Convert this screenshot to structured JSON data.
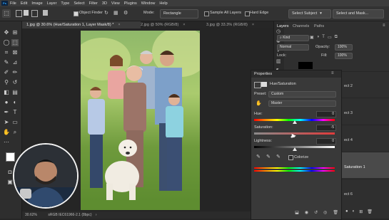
{
  "menu": [
    "File",
    "Edit",
    "Image",
    "Layer",
    "Type",
    "Select",
    "Filter",
    "3D",
    "View",
    "Plugins",
    "Window",
    "Help"
  ],
  "app_icon": "Ps",
  "options": {
    "object_finder": "Object Finder",
    "mode_label": "Mode:",
    "mode_value": "Rectangle",
    "sample_all_layers": "Sample All Layers",
    "hard_edge": "Hard Edge",
    "select_subject": "Select Subject",
    "select_and_mask": "Select and Mask..."
  },
  "tabs": [
    {
      "label": "1.jpg @ 30.6% (Hue/Saturation 1, Layer Mask/8) *"
    },
    {
      "label": "2.jpg @ 50% (RGB/8)"
    },
    {
      "label": "3.jpg @ 33.3% (RGB/8)"
    }
  ],
  "status": {
    "zoom": "30.62%",
    "info": "sRGB IEC61966-2.1 (8bpc)"
  },
  "layers_panel": {
    "tabs": [
      "Layers",
      "Channels",
      "Paths"
    ],
    "kind_label": "Kind",
    "blend_mode": "Normal",
    "opacity_label": "Opacity:",
    "opacity_value": "100%",
    "lock_label": "Lock:",
    "fill_label": "Fill:",
    "fill_value": "100%",
    "layers": [
      {
        "name": "ect 2"
      },
      {
        "name": "ect 3"
      },
      {
        "name": "ect 4"
      },
      {
        "name": "Saturation 1"
      },
      {
        "name": "ect 6"
      }
    ]
  },
  "properties": {
    "title": "Properties",
    "adjustment": "Hue/Saturation",
    "preset_label": "Preset:",
    "preset_value": "Custom",
    "channel": "Master",
    "hue_label": "Hue:",
    "hue_value": "0",
    "saturation_label": "Saturation:",
    "saturation_value": "-5",
    "lightness_label": "Lightness:",
    "lightness_value": "0",
    "colorize_label": "Colorize",
    "hue_pos": 0.5,
    "sat_pos": 0.48,
    "light_pos": 0.5
  },
  "colors": {
    "accent": "#31a8ff",
    "panel": "#393939",
    "selected_layer": "#4a4a4a"
  }
}
